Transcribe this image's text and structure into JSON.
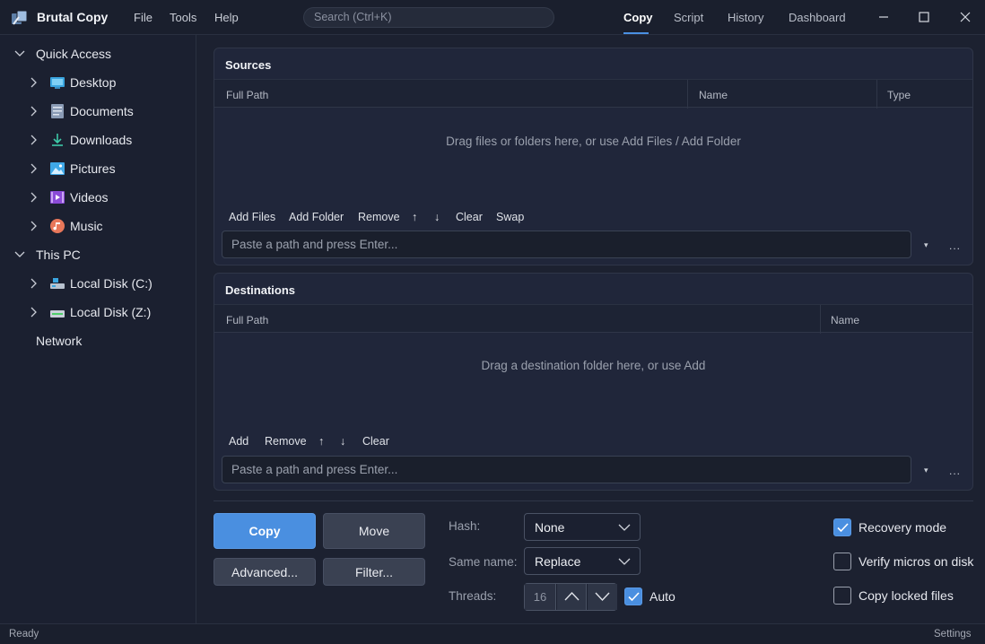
{
  "app": {
    "title": "Brutal Copy",
    "menu": [
      "File",
      "Tools",
      "Help"
    ],
    "search_placeholder": "Search   (Ctrl+K)",
    "nav_tabs": [
      "Copy",
      "Script",
      "History",
      "Dashboard"
    ],
    "active_tab": "Copy"
  },
  "sidebar": {
    "quick_access": "Quick Access",
    "quick_items": [
      {
        "label": "Desktop",
        "icon": "desktop-icon"
      },
      {
        "label": "Documents",
        "icon": "documents-icon"
      },
      {
        "label": "Downloads",
        "icon": "downloads-icon"
      },
      {
        "label": "Pictures",
        "icon": "pictures-icon"
      },
      {
        "label": "Videos",
        "icon": "videos-icon"
      },
      {
        "label": "Music",
        "icon": "music-icon"
      }
    ],
    "this_pc": "This PC",
    "drives": [
      {
        "label": "Local Disk (C:)",
        "icon": "disk-icon"
      },
      {
        "label": "Local Disk (Z:)",
        "icon": "disk-icon"
      }
    ],
    "network": "Network"
  },
  "sources": {
    "title": "Sources",
    "columns": [
      "Full Path",
      "Name",
      "Type"
    ],
    "empty_message": "Drag files or folders here, or use Add Files / Add Folder",
    "toolbar": [
      "Add Files",
      "Add Folder",
      "Remove",
      "↑",
      "↓",
      "Clear",
      "Swap"
    ],
    "path_placeholder": "Paste a path and press Enter...",
    "dropdown_arrow": "▾",
    "ellipsis": "..."
  },
  "destinations": {
    "title": "Destinations",
    "columns": [
      "Full Path",
      "Name"
    ],
    "empty_message": "Drag a destination folder here, or use Add",
    "toolbar": [
      "Add",
      "Remove",
      "↑",
      "↓",
      "Clear"
    ],
    "path_placeholder": "Paste a path and press Enter...",
    "dropdown_arrow": "▾",
    "ellipsis": "..."
  },
  "actions": {
    "copy": "Copy",
    "move": "Move",
    "advanced": "Advanced...",
    "filter": "Filter..."
  },
  "options": {
    "hash_label": "Hash:",
    "hash_value": "None",
    "same_name_label": "Same name:",
    "same_name_value": "Replace",
    "threads_label": "Threads:",
    "threads_value": "16",
    "auto_label": "Auto",
    "auto_checked": true,
    "recovery_mode_label": "Recovery mode",
    "recovery_mode_checked": true,
    "verify_label": "Verify micros on disk",
    "verify_checked": false,
    "locked_label": "Copy locked files",
    "locked_checked": false
  },
  "status": {
    "left": "Ready",
    "right": "Settings"
  },
  "colors": {
    "accent": "#4a8fe0",
    "background": "#1c2130",
    "panel": "#20263a"
  }
}
